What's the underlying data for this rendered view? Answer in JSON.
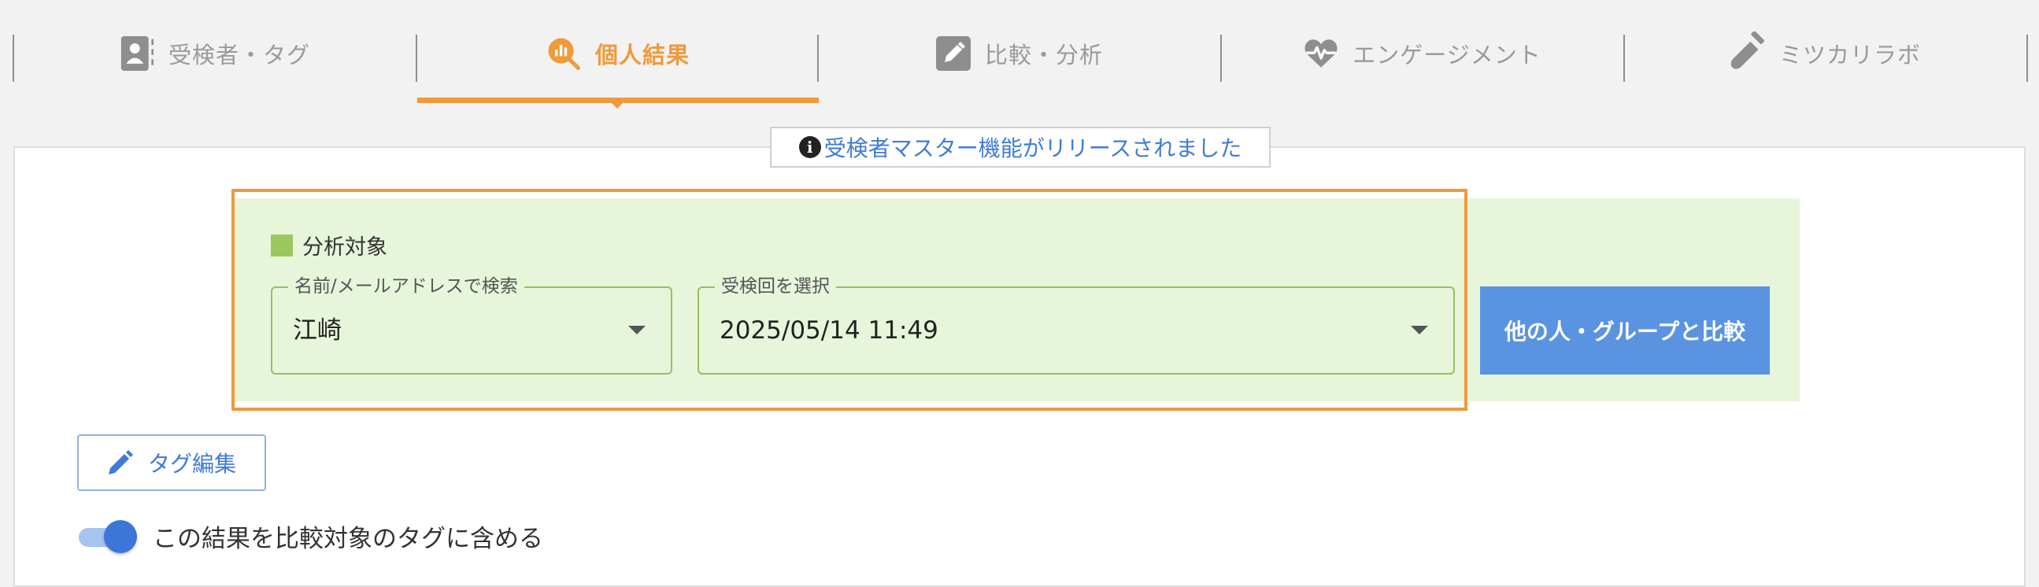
{
  "nav": {
    "items": [
      {
        "label": "受検者・タグ",
        "icon": "user-tag-icon"
      },
      {
        "label": "個人結果",
        "icon": "chart-search-icon",
        "active": true
      },
      {
        "label": "比較・分析",
        "icon": "edit-square-icon"
      },
      {
        "label": "エンゲージメント",
        "icon": "heartbeat-icon"
      },
      {
        "label": "ミツカリラボ",
        "icon": "test-tube-icon"
      }
    ],
    "active_color": "#ef9a3c",
    "inactive_color": "#9a9a9a"
  },
  "notice": {
    "text": "受検者マスター機能がリリースされました",
    "icon": "info-icon"
  },
  "analysis": {
    "title": "分析対象",
    "name_field": {
      "label": "名前/メールアドレスで検索",
      "value": "江崎"
    },
    "session_field": {
      "label": "受検回を選択",
      "value": "2025/05/14 11:49"
    },
    "compare_button": "他の人・グループと比較"
  },
  "tag_button": {
    "label": "タグ編集",
    "icon": "pencil-icon"
  },
  "toggle": {
    "label": "この結果を比較対象のタグに含める",
    "checked": true
  },
  "colors": {
    "accent_orange": "#ef9a3c",
    "primary_blue": "#5a93e0",
    "panel_green": "#e7f5da",
    "field_border_green": "#92c25f"
  }
}
